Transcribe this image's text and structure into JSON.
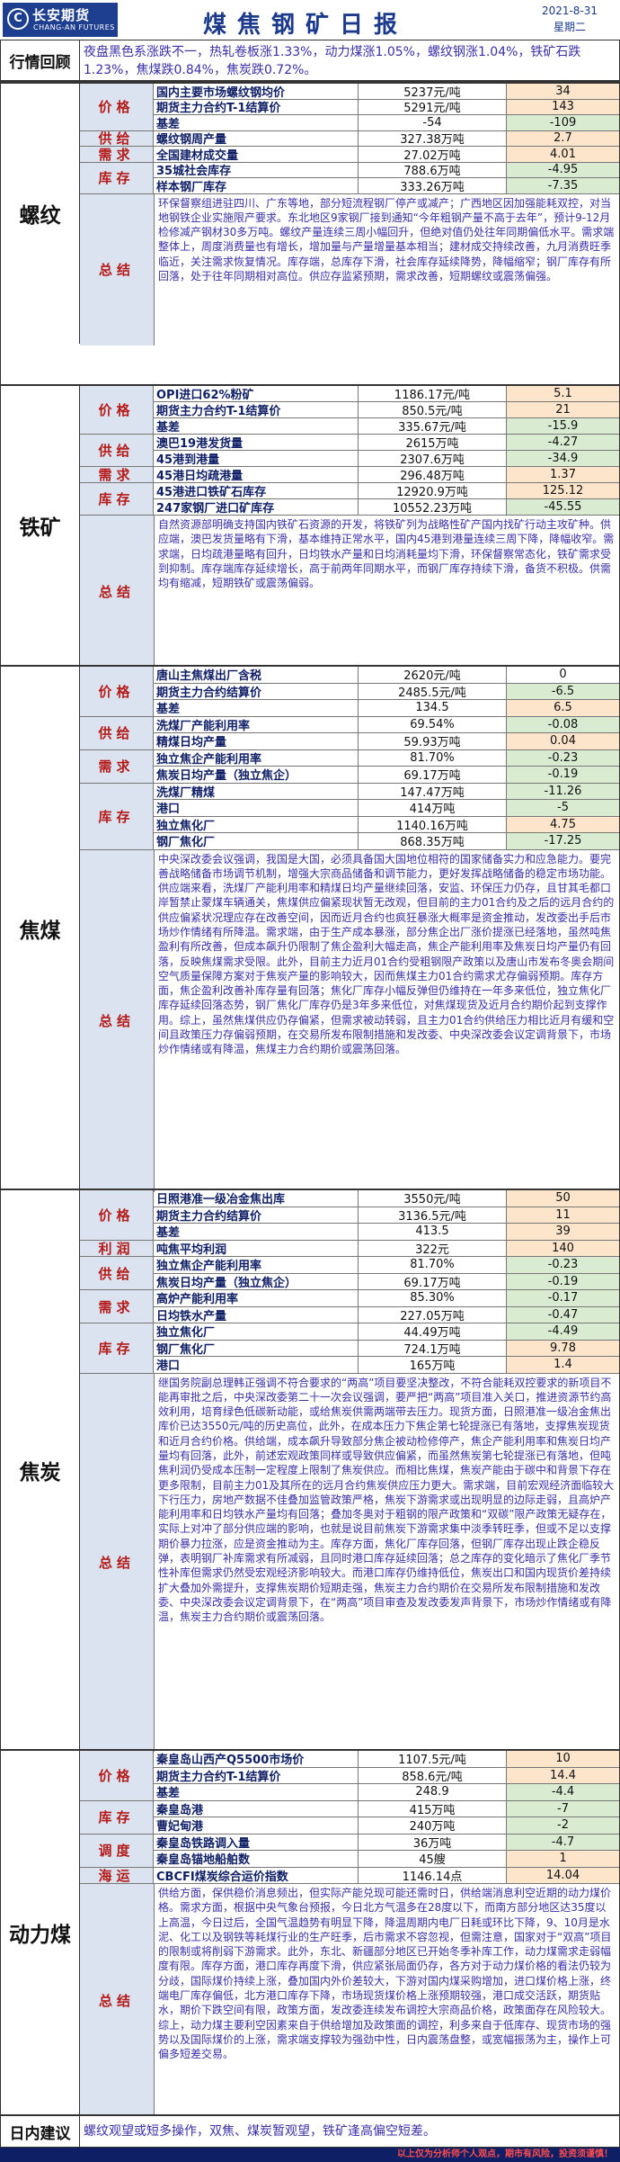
{
  "header": {
    "logo_mark": "C",
    "logo_cn": "长安期货",
    "logo_en": "CHANG-AN FUTURES",
    "title": "煤焦钢矿日报",
    "date": "2021-8-31",
    "weekday": "星期二"
  },
  "recap": {
    "label": "行情回顾",
    "text": "夜盘黑色系涨跌不一，热轧卷板涨1.33%，动力煤涨1.05%，螺纹钢涨1.04%，铁矿石跌1.23%，焦煤跌0.84%，焦炭跌0.72%。"
  },
  "sections": [
    {
      "name": "螺纹",
      "rows": [
        {
          "cat": "价格",
          "name": "国内主要市场螺纹钢均价",
          "v1": "5237元/吨",
          "v2": "34"
        },
        {
          "cat": "",
          "name": "期货主力合约T-1结算价",
          "v1": "5291元/吨",
          "v2": "143"
        },
        {
          "cat": "",
          "name": "基差",
          "v1": "-54",
          "v2": "-109"
        },
        {
          "cat": "供给",
          "name": "螺纹钢周产量",
          "v1": "327.38万吨",
          "v2": "2.7"
        },
        {
          "cat": "需求",
          "name": "全国建材成交量",
          "v1": "27.02万吨",
          "v2": "4.01"
        },
        {
          "cat": "库存",
          "name": "35城社会库存",
          "v1": "788.6万吨",
          "v2": "-4.95"
        },
        {
          "cat": "",
          "name": "样本钢厂库存",
          "v1": "333.26万吨",
          "v2": "-7.35"
        }
      ],
      "summary_label": "总结",
      "summary": "环保督察组进驻四川、广东等地，部分短流程钢厂停产或减产；广西地区因加强能耗双控，对当地钢铁企业实施限产要求。东北地区9家钢厂接到通知“今年粗钢产量不高于去年”，预计9-12月检修减产钢材30多万吨。螺纹产量连续三周小幅回升，但绝对值仍处往年同期偏低水平。需求端整体上，周度消费量也有增长，增加量与产量增量基本相当；建材成交持续改善，九月消费旺季临近，关注需求恢复情况。库存端，总库存下滑，社会库存延续降势，降幅缩窄；钢厂库存有所回落，处于往年同期相对高位。供应存监紧预期，需求改善，短期螺纹或震荡偏强。"
    },
    {
      "name": "铁矿",
      "rows": [
        {
          "cat": "价格",
          "name": "OPI进口62%粉矿",
          "v1": "1186.17元/吨",
          "v2": "5.1"
        },
        {
          "cat": "",
          "name": "期货主力合约T-1结算价",
          "v1": "850.5元/吨",
          "v2": "21"
        },
        {
          "cat": "",
          "name": "基差",
          "v1": "335.67元/吨",
          "v2": "-15.9"
        },
        {
          "cat": "供给",
          "name": "澳巴19港发货量",
          "v1": "2615万吨",
          "v2": "-4.27"
        },
        {
          "cat": "",
          "name": "45港到港量",
          "v1": "2307.6万吨",
          "v2": "-34.9"
        },
        {
          "cat": "需求",
          "name": "45港日均疏港量",
          "v1": "296.48万吨",
          "v2": "1.37"
        },
        {
          "cat": "库存",
          "name": "45港进口铁矿石库存",
          "v1": "12920.9万吨",
          "v2": "125.12"
        },
        {
          "cat": "",
          "name": "247家钢厂进口矿库存",
          "v1": "10552.23万吨",
          "v2": "-45.55"
        }
      ],
      "summary_label": "总结",
      "summary": "自然资源部明确支持国内铁矿石资源的开发，将铁矿列为战略性矿产国内找矿行动主攻矿种。供应端，澳巴发货量略有下滑，基本维持正常水平，国内45港到港量连续三周下降，降幅收窄。需求端，日均疏港量略有回升，日均铁水产量和日均消耗量均下滑，环保督察常态化，铁矿需求受到抑制。库存端库存延续增长，高于前两年同期水平，而钢厂库存持续下滑，备货不积极。供需均有缩减，短期铁矿或震荡偏弱。"
    },
    {
      "name": "焦煤",
      "rows": [
        {
          "cat": "价格",
          "name": "唐山主焦煤出厂含税",
          "v1": "2620元/吨",
          "v2": "0"
        },
        {
          "cat": "",
          "name": "期货主力合约结算价",
          "v1": "2485.5元/吨",
          "v2": "-6.5"
        },
        {
          "cat": "",
          "name": "基差",
          "v1": "134.5",
          "v2": "6.5"
        },
        {
          "cat": "供给",
          "name": "洗煤厂产能利用率",
          "v1": "69.54%",
          "v2": "-0.08"
        },
        {
          "cat": "",
          "name": "精煤日均产量",
          "v1": "59.93万吨",
          "v2": "0.04"
        },
        {
          "cat": "需求",
          "name": "独立焦企产能利用率",
          "v1": "81.70%",
          "v2": "-0.23"
        },
        {
          "cat": "",
          "name": "焦炭日均产量（独立焦企）",
          "v1": "69.17万吨",
          "v2": "-0.19"
        },
        {
          "cat": "库存",
          "name": "洗煤厂精煤",
          "v1": "147.47万吨",
          "v2": "-11.26"
        },
        {
          "cat": "",
          "name": "港口",
          "v1": "414万吨",
          "v2": "-5"
        },
        {
          "cat": "",
          "name": "独立焦化厂",
          "v1": "1140.16万吨",
          "v2": "4.75"
        },
        {
          "cat": "",
          "name": "钢厂焦化厂",
          "v1": "868.35万吨",
          "v2": "-17.25"
        }
      ],
      "summary_label": "总结",
      "summary": "中央深改委会议强调，我国是大国，必须具备国大国地位相符的国家储备实力和应急能力。要完善战略储备市场调节机制，增强大宗商品储备和调节能力，更好发挥战略储备的稳定市场功能。供应端来看，洗煤厂产能利用率和精煤日均产量继续回落，安监、环保压力仍存，且甘其毛都口岸暂禁止蒙煤车辆通关，焦煤供应偏紧现状暂无改观，但目前的主力01合约及之后的远月合约的供应偏紧状况理应存在改善空间，因而近月合约也疯狂暴涨大概率是资金推动，发改委出手后市场炒作情绪有所降温。需求端，由于生产成本暴涨，部分焦企出厂涨价提涨已经落地，虽然吨焦盈利有所改善，但成本飙升仍限制了焦企盈利大幅走高，焦企产能利用率及焦炭日均产量仍有回落，反映焦煤需求受限。此外，目前主力近月01合约受粗钢限产政策以及唐山市发布冬奥会期间空气质量保障方案对于焦炭产量的影响较大，因而焦煤主力01合约需求尤存偏弱预期。库存方面，焦企盈利改善补库存量有回落；焦化厂库存小幅反弹但仍维持在一年多来低位，独立焦化厂库存延续回落态势，钢厂焦化厂库存仍是3年多来低位，对焦煤现货及近月合约期价起到支撑作用。综上，虽然焦煤供应仍存偏紧，但需求被动转弱，且主力01合约供给压力相比近月有缓和空间且政策压力存偏弱预期，在交易所发布限制措施和发改委、中央深改委会议定调背景下，市场炒作情绪或有降温，焦煤主力合约期价或震荡回落。"
    },
    {
      "name": "焦炭",
      "rows": [
        {
          "cat": "价格",
          "name": "日照港准一级冶金焦出库",
          "v1": "3550元/吨",
          "v2": "50"
        },
        {
          "cat": "",
          "name": "期货主力合约结算价",
          "v1": "3136.5元/吨",
          "v2": "11"
        },
        {
          "cat": "",
          "name": "基差",
          "v1": "413.5",
          "v2": "39"
        },
        {
          "cat": "利润",
          "name": "吨焦平均利润",
          "v1": "322元",
          "v2": "140"
        },
        {
          "cat": "供给",
          "name": "独立焦企产能利用率",
          "v1": "81.70%",
          "v2": "-0.23"
        },
        {
          "cat": "",
          "name": "焦炭日均产量（独立焦企）",
          "v1": "69.17万吨",
          "v2": "-0.19"
        },
        {
          "cat": "需求",
          "name": "高炉产能利用率",
          "v1": "85.30%",
          "v2": "-0.17"
        },
        {
          "cat": "",
          "name": "日均铁水产量",
          "v1": "227.05万吨",
          "v2": "-0.47"
        },
        {
          "cat": "库存",
          "name": "独立焦化厂",
          "v1": "44.49万吨",
          "v2": "-4.49"
        },
        {
          "cat": "",
          "name": "钢厂焦化厂",
          "v1": "724.1万吨",
          "v2": "9.78"
        },
        {
          "cat": "",
          "name": "港口",
          "v1": "165万吨",
          "v2": "1.4"
        }
      ],
      "summary_label": "总结",
      "summary": "继国务院副总理韩正强调不符合要求的“两高”项目要坚决整改，不符合能耗双控要求的新项目不能再审批之后，中央深改委第二十一次会议强调，要严把“两高”项目准入关口，推进资源节约高效利用，培育绿色低碳新动能，或给焦炭供需两端带去压力。现货方面，日照港准一级冶金焦出库价已达3550元/吨的历史高位，此外，在成本压力下焦企第七轮提涨已有落地，支撑焦炭现货和近月合约价格。供给端，成本飙升导致部分焦企被动检修停产，焦企产能利用率和焦炭日均产量均有回落，此外，前述宏观政策同样或导致供应偏紧，而虽然焦炭第七轮提涨已有落地，但吨焦利润仍受成本压制一定程度上限制了焦炭供应。而相比焦煤，焦炭产能由于碳中和背景下存在更多限制，目前主力01及其所在的远月合约焦炭供应压力更大。需求端，目前宏观经济面临较大下行压力，房地产数据不佳叠加监管政策严格，焦炭下游需求或出现明显的边际走弱，且高炉产能利用率和日均铁水产量均有回落；叠加冬奥对于粗钢的限产政策和“双碳”限产政策无疑存在，实际上对冲了部分供应端的影响，也就是说目前焦炭下游需求集中淡季转旺季，但或不足以支撑期价暴力拉涨，应是资金推动为主。库存方面，焦化厂库存回落，但钢厂库存出现止跌企稳反弹，表明钢厂补库需求有所减弱，且同时港口库存延续回落；总之库存的变化暗示了焦化厂季节性补库但需求仍然受宏观经济影响较大。而港口库存仍维持低位，焦炭出口和国内现货价差持续扩大叠加外需提升，支撑焦炭期价短期走强，焦炭主力合约期价在交易所发布限制措施和发改委、中央深改委会议定调背景下，在“两高”项目审查及发改委发声背景下，市场炒作情绪或有降温，焦炭主力合约期价或震荡回落。"
    },
    {
      "name": "动力煤",
      "rows": [
        {
          "cat": "价格",
          "name": "秦皇岛山西产Q5500市场价",
          "v1": "1107.5元/吨",
          "v2": "10"
        },
        {
          "cat": "",
          "name": "期货主力合约T-1结算价",
          "v1": "858.6元/吨",
          "v2": "14.4"
        },
        {
          "cat": "",
          "name": "基差",
          "v1": "248.9",
          "v2": "-4.4"
        },
        {
          "cat": "库存",
          "name": "秦皇岛港",
          "v1": "415万吨",
          "v2": "-7"
        },
        {
          "cat": "",
          "name": "曹妃甸港",
          "v1": "240万吨",
          "v2": "-2"
        },
        {
          "cat": "调度",
          "name": "秦皇岛铁路调入量",
          "v1": "36万吨",
          "v2": "-4.7"
        },
        {
          "cat": "",
          "name": "秦皇岛锚地船舶数",
          "v1": "45艘",
          "v2": "1"
        },
        {
          "cat": "海运",
          "name": "CBCFI煤炭综合运价指数",
          "v1": "1146.14点",
          "v2": "14.04"
        }
      ],
      "summary_label": "总结",
      "summary": "供给方面，保供稳价消息频出，但实际产能兑现可能还需时日，供给端消息利空近期的动力煤价格。需求方面，根据中央气象台预报，今日北方气温多在28度以下，而南方部分地区达35度以上高温，今日过后，全国气温趋势有明显下降，降温周期内电厂日耗或环比下降，9、10月是水泥、化工以及钢铁等耗煤行业的生产旺季，后市需求不容忽视，但需注意，国家对于“双高”项目的限制或将削弱下游需求。此外，东北、新疆部分地区已开始冬季补库工作，动力煤需求走弱幅度有限。库存方面，港口库存再度下滑，供应紧张局面仍存，各方对于动力煤价格的看法仍较为分歧，国际煤价持续上涨，叠加国内外价差较大，下游对国内煤采购增加，进口煤价格上涨，终端电厂库存偏低，北方港口库存下降，市场现货煤价格上涨预期较强，港口成交活跃，期货贴水，期价下跌空间有限，政策方面，发改委连续发布调控大宗商品价格，政策面存在风险较大。综上，动力煤主要利空因素来自于供给增加及政策面的调控，利多来自于低库存、现货市场的强势以及国际煤价的上涨，需求端支撑较为强劲中性，日内震荡盘整，或宽幅振荡为主，操作上可偏多短差交易。"
    }
  ],
  "intraday": {
    "label": "日内建议",
    "text": "螺纹观望或短多操作，双焦、煤炭暂观望，铁矿逢高偏空短差。"
  },
  "footer": "以上仅为分析师个人观点，期市有风险，投资须谨慎！",
  "colors": {
    "brand": "#1e3f8f",
    "category_red": "#b51b18",
    "summary_text": "#3a2fa6",
    "up_bg": "#fde5cb",
    "down_bg": "#d9ecd2"
  }
}
